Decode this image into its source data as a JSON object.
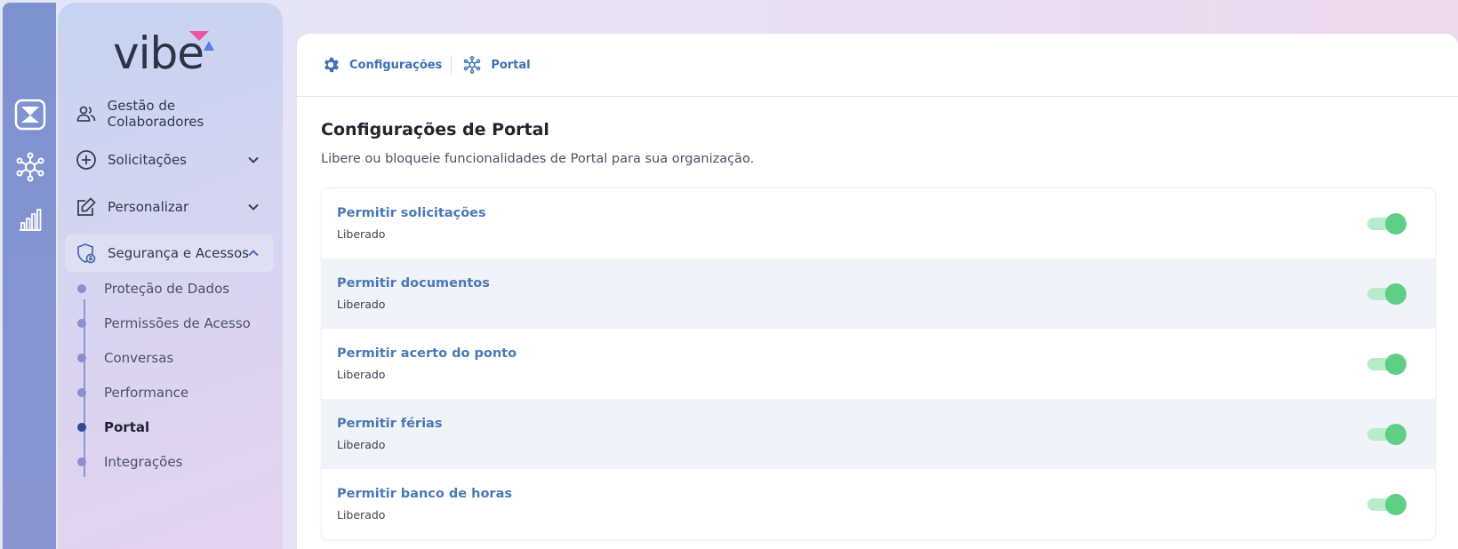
{
  "app": {
    "logo_text": "vibe"
  },
  "rail": {
    "items": [
      "vibe-app-icon",
      "network-icon",
      "bar-chart-icon"
    ]
  },
  "sidebar": {
    "items": [
      {
        "label": "Gestão de Colaboradores",
        "icon": "people-icon"
      },
      {
        "label": "Solicitações",
        "icon": "plus-circle-icon",
        "expandable": true
      },
      {
        "label": "Personalizar",
        "icon": "edit-icon",
        "expandable": true
      },
      {
        "label": "Segurança e Acessos",
        "icon": "shield-lock-icon",
        "expanded": true
      }
    ],
    "subitems": [
      {
        "label": "Proteção de Dados"
      },
      {
        "label": "Permissões de Acesso"
      },
      {
        "label": "Conversas"
      },
      {
        "label": "Performance"
      },
      {
        "label": "Portal",
        "current": true
      },
      {
        "label": "Integrações"
      }
    ]
  },
  "breadcrumb": [
    {
      "label": "Configurações",
      "icon": "gear-icon"
    },
    {
      "label": "Portal",
      "icon": "network-icon"
    }
  ],
  "page": {
    "title": "Configurações de Portal",
    "description": "Libere ou bloqueie funcionalidades de Portal para sua organização."
  },
  "settings": [
    {
      "title": "Permitir solicitações",
      "status": "Liberado",
      "enabled": true
    },
    {
      "title": "Permitir documentos",
      "status": "Liberado",
      "enabled": true
    },
    {
      "title": "Permitir acerto do ponto",
      "status": "Liberado",
      "enabled": true
    },
    {
      "title": "Permitir férias",
      "status": "Liberado",
      "enabled": true
    },
    {
      "title": "Permitir banco de horas",
      "status": "Liberado",
      "enabled": true
    }
  ],
  "colors": {
    "accent": "#4c78b6",
    "toggle_on": "#5fcf86",
    "toggle_track": "#b7ecca"
  }
}
